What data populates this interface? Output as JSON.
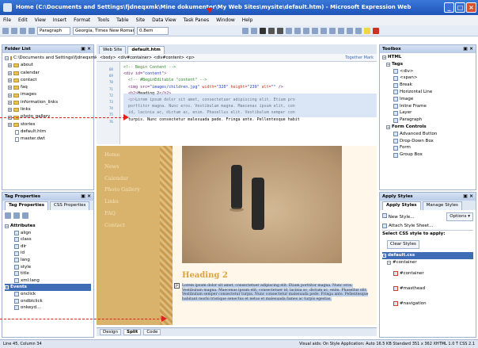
{
  "window": {
    "title": "Home (C:\\Documents and Settings\\fjdneqxmk\\Mine dokumenter\\My Web Sites\\mysite\\default.htm) - Microsoft Expression Web",
    "minimize": "_",
    "maximize": "□",
    "close": "×"
  },
  "menu": [
    "File",
    "Edit",
    "View",
    "Insert",
    "Format",
    "Tools",
    "Table",
    "Site",
    "Data View",
    "Task Panes",
    "Window",
    "Help"
  ],
  "toolbar": {
    "style_box": "Paragraph",
    "font_box": "Georgia, Times New Roman",
    "size_box": "0.8em"
  },
  "folder_list": {
    "header": "Folder List",
    "root": "C:\\Documents and Settings\\fjdneqxmk",
    "items": [
      {
        "label": "about",
        "type": "folder"
      },
      {
        "label": "calendar",
        "type": "folder"
      },
      {
        "label": "contact",
        "type": "folder"
      },
      {
        "label": "faq",
        "type": "folder"
      },
      {
        "label": "images",
        "type": "folder"
      },
      {
        "label": "information_links",
        "type": "folder"
      },
      {
        "label": "links",
        "type": "folder"
      },
      {
        "label": "photo_gallery",
        "type": "folder"
      },
      {
        "label": "stories",
        "type": "folder"
      },
      {
        "label": "default.htm",
        "type": "file"
      },
      {
        "label": "master.dwt",
        "type": "file"
      }
    ]
  },
  "tag_props": {
    "header": "Tag Properties",
    "tabs": [
      "Tag Properties",
      "CSS Properties"
    ],
    "attributes_section": "Attributes",
    "attributes": [
      "align",
      "class",
      "dir",
      "id",
      "lang",
      "style",
      "title",
      "xml:lang"
    ],
    "events_section": "Events",
    "events": [
      "onclick",
      "ondblclick",
      "onkeyd..."
    ]
  },
  "doc_tabs": [
    "Web Site",
    "default.htm"
  ],
  "quick_tag": {
    "path": "<body> <div#container> <div#content> <p>",
    "right_label": "Together Mark"
  },
  "code": {
    "lines": [
      {
        "num": "68",
        "html": "<span class='c-cm'>&lt;!-- Begin Content --&gt;</span>"
      },
      {
        "num": "69",
        "html": "<span class='c-tag'>&lt;div id=</span><span class='c-val'>\"content\"</span><span class='c-tag'>&gt;</span>"
      },
      {
        "num": "70",
        "html": "&nbsp;&nbsp;<span class='c-cm'>&lt;!-- #BeginEditable \"content\" --&gt;</span>"
      },
      {
        "num": "71",
        "html": "&nbsp;&nbsp;<span class='c-tag'>&lt;img src=</span><span class='c-val'>\"images/children.jpg\"</span> <span class='c-attr'>width=</span><span class='c-val'>\"320\"</span> <span class='c-attr'>height=</span><span class='c-val'>\"239\"</span> <span class='c-attr'>alt=</span><span class='c-val'>\"\"</span> <span class='c-tag'>/&gt;</span>"
      },
      {
        "num": "72",
        "html": "&nbsp;&nbsp;<span class='c-tag'>&lt;h2&gt;</span>Heading 2<span class='c-tag'>&lt;/h2&gt;</span>"
      },
      {
        "num": "73",
        "html": "&nbsp;&nbsp;<span class='c-tag'>&lt;p&gt;</span>Lorem ipsum dolor sit amet, consectetuer adipiscing elit. Etiam pro"
      },
      {
        "num": "74",
        "html": "&nbsp;&nbsp;porttitor magna. Nunc eros. Vestibulum magna. Maecenas ipsum elit, con"
      },
      {
        "num": "75",
        "html": "&nbsp;&nbsp;id, lacinia ac, dictum ac, enim. Phasellus elit. Vestibulum semper con"
      },
      {
        "num": "76",
        "html": "&nbsp;&nbsp;turpis. Nunc consectetur malesuada pede. Fringa ante. Pellentesque habit"
      }
    ]
  },
  "design": {
    "nav_links": [
      "Home",
      "News",
      "Calendar",
      "Photo Gallery",
      "Links",
      "FAQ",
      "Contact"
    ],
    "heading": "Heading 2",
    "para_marker": "p",
    "body_text": "Lorem ipsum dolor sit amet, consectetuer adipiscing elit. Etiam porttitor magna. Nunc eros. Vestibulum magna. Maecenas ipsum elit, consectetuer id, lacinia ac, dictum ac, enim. Phasellus elit. Vestibulum semper consectetur turpis. Nunc consectetur malesuada pede. Fringa ante. Pellentesque habitant morbi tristique senectus et netus et malesuada fames ac turpis egestas."
  },
  "view_tabs": [
    "Design",
    "Split",
    "Code"
  ],
  "toolbox": {
    "header": "Toolbox",
    "html_section": "HTML",
    "tags_section": "Tags",
    "tags": [
      "<div>",
      "<span>",
      "Break",
      "Horizontal Line",
      "Image",
      "Inline Frame",
      "Layer",
      "Paragraph"
    ],
    "forms_section": "Form Controls",
    "forms": [
      "Advanced Button",
      "Drop-Down Box",
      "Form",
      "Group Box"
    ]
  },
  "apply_styles": {
    "header": "Apply Styles",
    "tabs": [
      "Apply Styles",
      "Manage Styles"
    ],
    "new_style": "New Style...",
    "options": "Options ▾",
    "attach_sheet": "Attach Style Sheet...",
    "select_label": "Select CSS style to apply:",
    "clear": "Clear Styles",
    "sheet": "default.css",
    "rule": "#container",
    "children": [
      "#container",
      "#masthead",
      "#navigation"
    ]
  },
  "status": {
    "left": "Line 45, Column 34",
    "right": "Visual aids:  On   Style Application:  Auto   16.5 KB   Standard   351 x 362   XHTML 1.0 T   CSS 2.1"
  },
  "annotation_color": "#e0201f"
}
